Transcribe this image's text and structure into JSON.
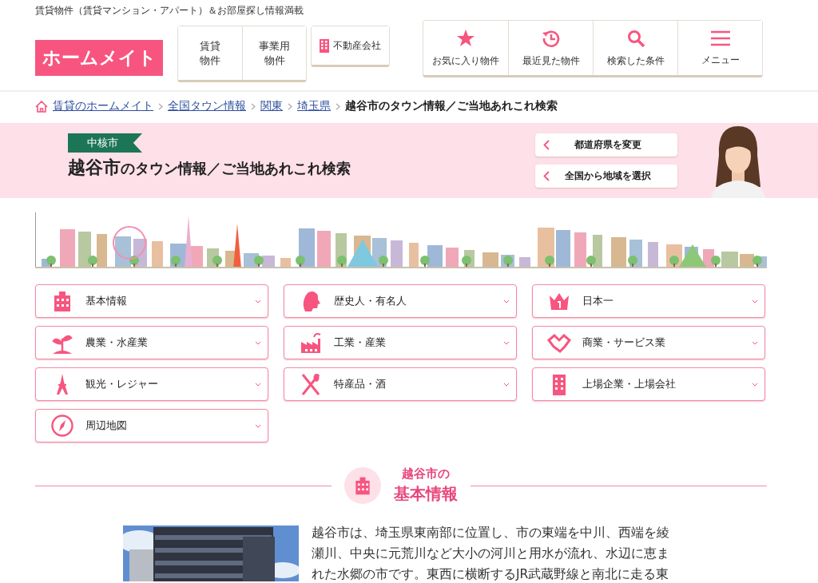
{
  "tagline": "賃貸物件（賃貸マンション・アパート）＆お部屋探し情報満載",
  "logo": "ホームメイト",
  "property_nav": [
    {
      "lines": [
        "賃貸",
        "物件"
      ]
    },
    {
      "lines": [
        "事業用",
        "物件"
      ]
    }
  ],
  "agency_button": "不動産会社",
  "user_nav": [
    {
      "label": "お気に入り物件"
    },
    {
      "label": "最近見た物件"
    },
    {
      "label": "検索した条件"
    },
    {
      "label": "メニュー"
    }
  ],
  "breadcrumb": [
    {
      "label": "賃貸のホームメイト",
      "link": true
    },
    {
      "label": "全国タウン情報",
      "link": true
    },
    {
      "label": "関東",
      "link": true
    },
    {
      "label": "埼玉県",
      "link": true
    },
    {
      "label": "越谷市のタウン情報／ご当地あれこれ検索",
      "link": false
    }
  ],
  "banner": {
    "tag": "中核市",
    "title_city": "越谷市",
    "title_rest": "のタウン情報／ご当地あれこれ検索",
    "buttons": [
      "都道府県を変更",
      "全国から地域を選択"
    ]
  },
  "categories": [
    {
      "label": "基本情報"
    },
    {
      "label": "歴史人・有名人"
    },
    {
      "label": "日本一"
    },
    {
      "label": "農業・水産業"
    },
    {
      "label": "工業・産業"
    },
    {
      "label": "商業・サービス業"
    },
    {
      "label": "観光・レジャー"
    },
    {
      "label": "特産品・酒"
    },
    {
      "label": "上場企業・上場会社"
    },
    {
      "label": "周辺地図"
    }
  ],
  "section": {
    "city": "越谷市の",
    "title": "基本情報",
    "text": "越谷市は、埼玉県東南部に位置し、市の東端を中川、西端を綾瀬川、中央に元荒川など大小の河川と用水が流れ、水辺に恵まれた水郷の市です。東西に横断するJR武蔵野線と南北に走る東"
  }
}
